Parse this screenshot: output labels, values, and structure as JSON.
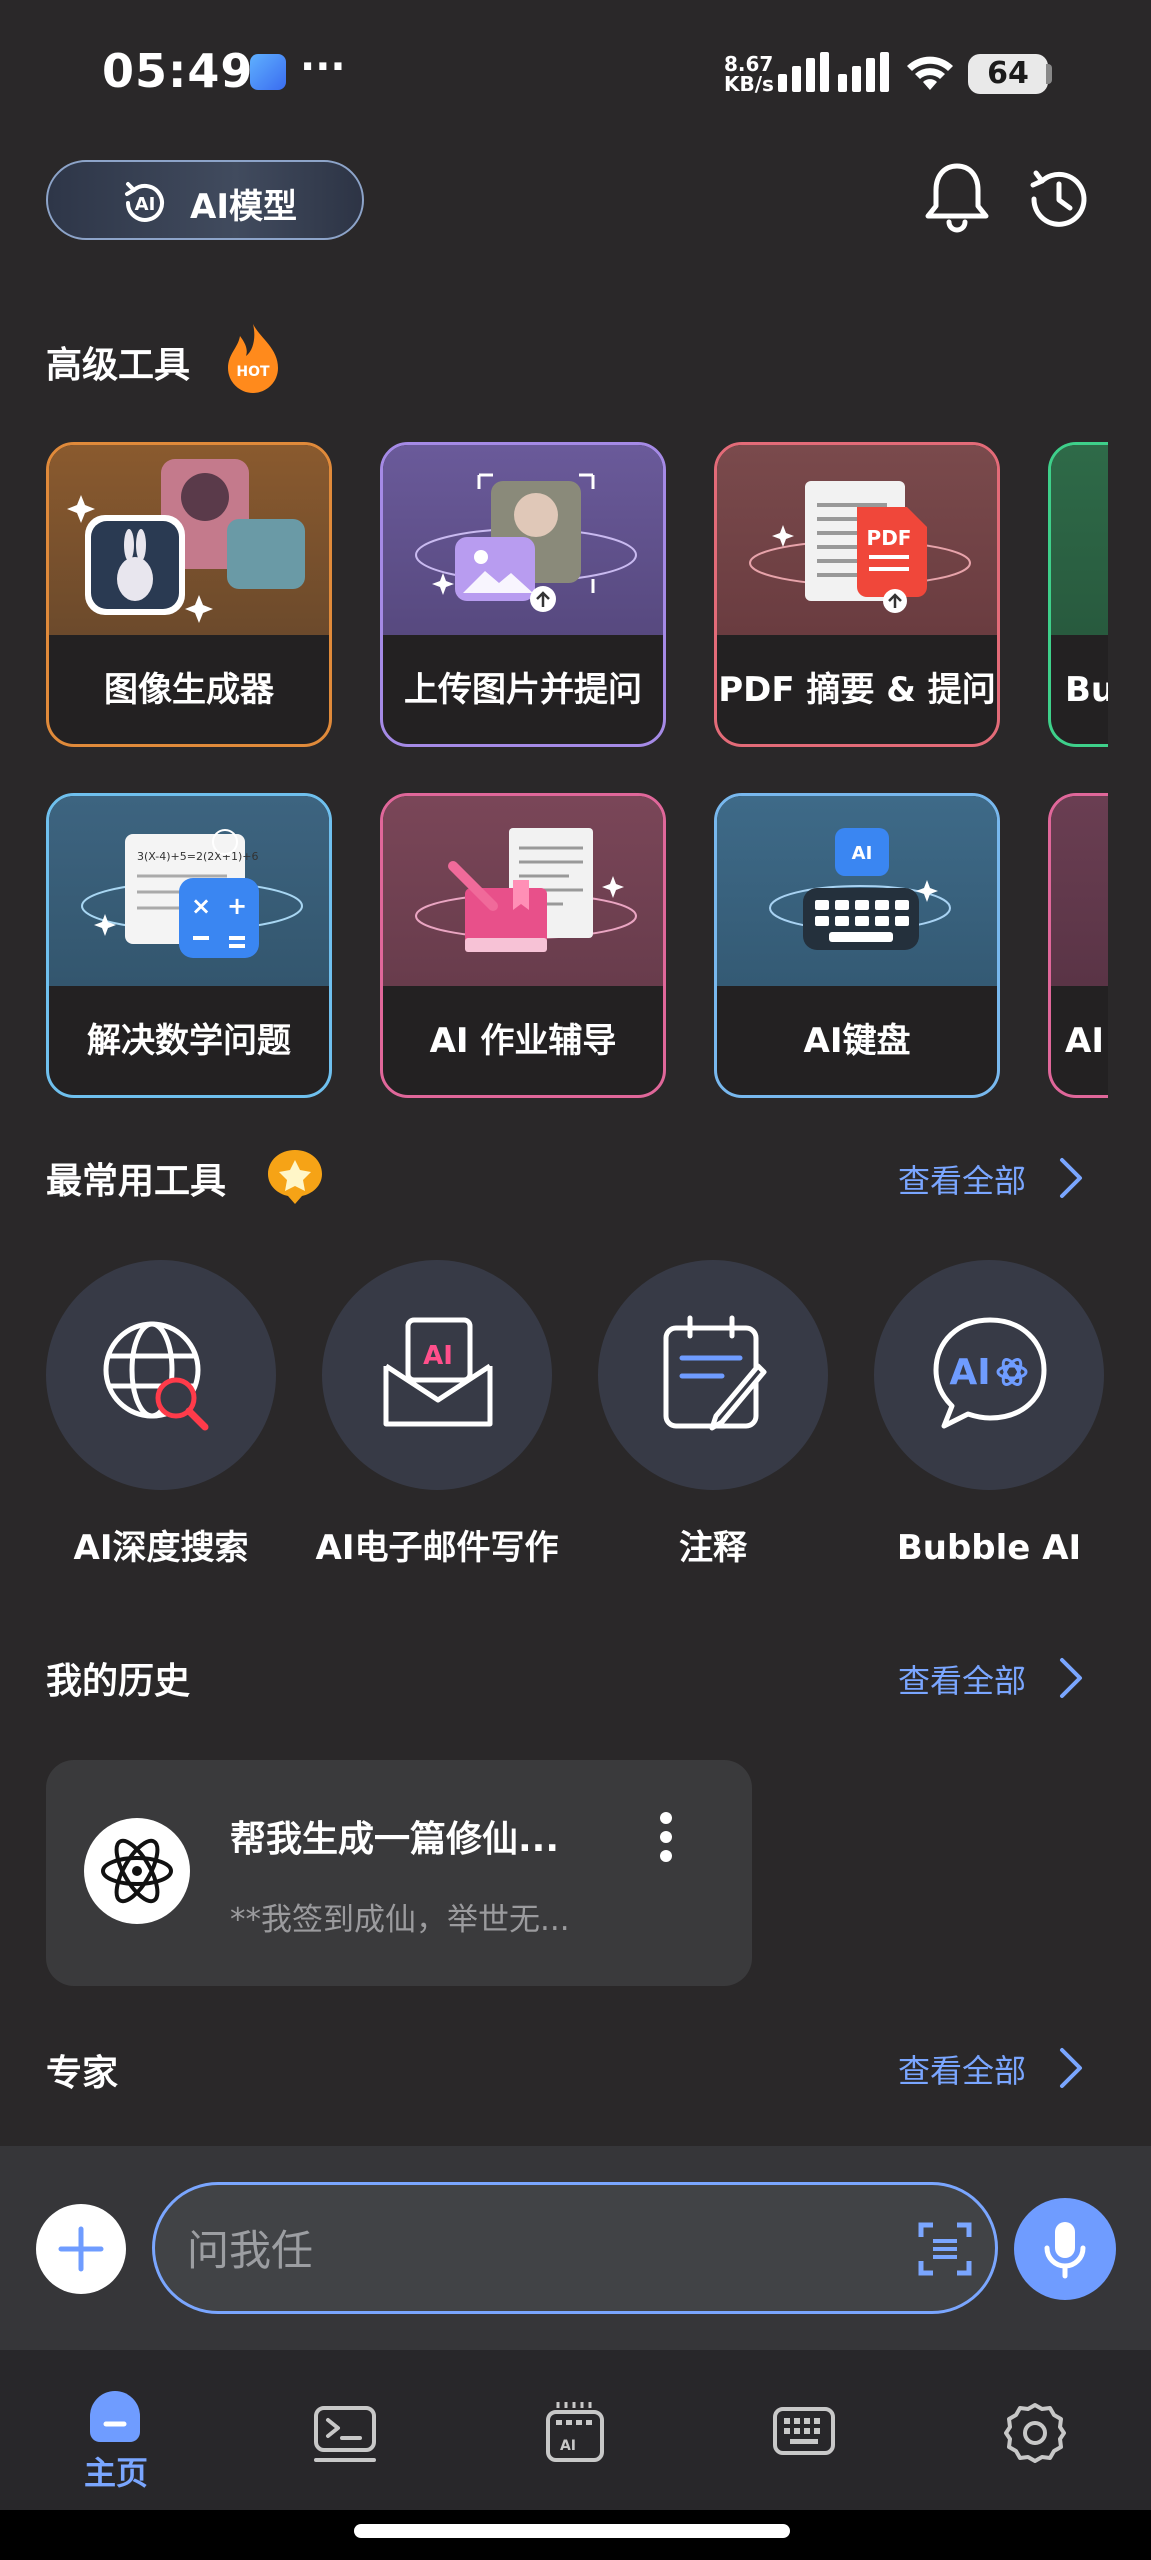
{
  "status_bar": {
    "time": "05:49",
    "dots": "···",
    "net_speed_value": "8.67",
    "net_speed_unit": "KB/s",
    "battery": "64"
  },
  "header": {
    "model_button_label": "AI模型"
  },
  "advanced_tools": {
    "title": "高级工具",
    "hot_badge": "HOT",
    "row1": [
      {
        "label": "图像生成器",
        "border": "#e08a3a",
        "art": "image-generator"
      },
      {
        "label": "上传图片并提问",
        "border": "#a58ae6",
        "art": "upload-image"
      },
      {
        "label": "PDF 摘要 & 提问",
        "border": "#e36b78",
        "art": "pdf"
      },
      {
        "label": "Bu",
        "border": "#3ed08a",
        "art": "partial"
      }
    ],
    "row2": [
      {
        "label": "解决数学问题",
        "border": "#6fc0ee",
        "art": "math"
      },
      {
        "label": "AI 作业辅导",
        "border": "#e0679a",
        "art": "homework"
      },
      {
        "label": "AI键盘",
        "border": "#78b8ee",
        "art": "keyboard"
      },
      {
        "label": "AI",
        "border": "#e0679a",
        "art": "partial"
      }
    ]
  },
  "frequent_tools": {
    "title": "最常用工具",
    "view_all": "查看全部",
    "items": [
      {
        "label": "AI深度搜索",
        "icon": "globe-search-icon"
      },
      {
        "label": "AI电子邮件写作",
        "icon": "ai-mail-icon"
      },
      {
        "label": "注释",
        "icon": "note-pen-icon"
      },
      {
        "label": "Bubble AI",
        "icon": "ai-chat-bubble-icon"
      }
    ]
  },
  "my_history": {
    "title": "我的历史",
    "view_all": "查看全部",
    "items": [
      {
        "title": "帮我生成一篇修仙...",
        "subtitle": "**我签到成仙，举世无..."
      }
    ]
  },
  "experts": {
    "title": "专家",
    "view_all": "查看全部"
  },
  "input": {
    "placeholder": "问我任"
  },
  "bottom_nav": {
    "items": [
      {
        "label": "主页",
        "icon": "home-icon",
        "active": true
      },
      {
        "icon": "terminal-icon"
      },
      {
        "icon": "ai-keyboard-icon"
      },
      {
        "icon": "keyboard-icon"
      },
      {
        "icon": "settings-gear-icon"
      }
    ]
  },
  "colors": {
    "accent": "#7aa6ff",
    "background": "#2a2829",
    "card_dark": "#3a3a3c"
  }
}
